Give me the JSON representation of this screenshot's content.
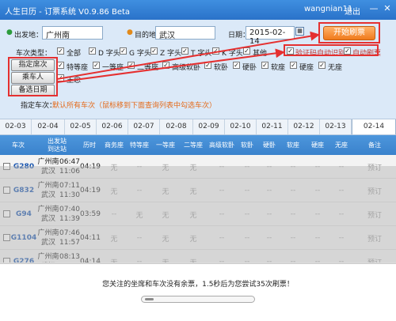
{
  "window": {
    "title": "人生日历 - 订票系统 V0.9.86 Beta",
    "username": "wangnian11",
    "logout": "退出",
    "minimize": "—",
    "close": "✕"
  },
  "form": {
    "from_label": "出发地：",
    "from_value": "广州南",
    "to_label": "目的地：",
    "to_value": "武汉",
    "date_label": "日期：",
    "date_value": "2015-02-14",
    "start_button": "开始刷票",
    "train_type_label": "车次类型：",
    "train_types": [
      {
        "label": "全部",
        "checked": true
      },
      {
        "label": "D 字头",
        "checked": true
      },
      {
        "label": "G 字头",
        "checked": true
      },
      {
        "label": "Z 字头",
        "checked": true
      },
      {
        "label": "T 字头",
        "checked": true
      },
      {
        "label": "K 字头",
        "checked": true
      },
      {
        "label": "其他",
        "checked": true
      }
    ],
    "auto_captcha": "验证码自动识别",
    "auto_refresh": "自动刷票",
    "specify_seat_button": "指定席次",
    "seats": [
      {
        "label": "特等座",
        "checked": true
      },
      {
        "label": "一等座",
        "checked": true
      },
      {
        "label": "二等座",
        "checked": true
      },
      {
        "label": "高级软卧",
        "checked": true
      },
      {
        "label": "软卧",
        "checked": true
      },
      {
        "label": "硬卧",
        "checked": true
      },
      {
        "label": "软座",
        "checked": true
      },
      {
        "label": "硬座",
        "checked": true
      },
      {
        "label": "无座",
        "checked": true
      }
    ],
    "passenger_button": "乘车人",
    "passenger_name": "王念",
    "backup_date_button": "备选日期",
    "specify_train_label": "指定车次：",
    "specify_train_hint": "默认所有车次（鼠标移到下面查询列表中勾选车次）"
  },
  "date_tabs": [
    "02-03",
    "02-04",
    "02-05",
    "02-06",
    "02-07",
    "02-08",
    "02-09",
    "02-10",
    "02-11",
    "02-12",
    "02-13",
    "02-14"
  ],
  "active_tab": "02-14",
  "table": {
    "headers": [
      "车次",
      "出发站\n到达站",
      "历时",
      "商务座",
      "特等座",
      "一等座",
      "二等座",
      "高级软卧",
      "软卧",
      "硬卧",
      "软座",
      "硬座",
      "无座",
      "备注"
    ],
    "rows": [
      {
        "code": "G280",
        "from": "广州南",
        "to": "武汉",
        "dep": "06:47",
        "arr": "11:06",
        "dur": "04:19",
        "seats": [
          "无",
          "--",
          "无",
          "无",
          "--",
          "--",
          "--",
          "--",
          "--",
          "--"
        ],
        "note": "预订"
      },
      {
        "code": "G832",
        "from": "广州南",
        "to": "武汉",
        "dep": "07:11",
        "arr": "11:30",
        "dur": "04:19",
        "seats": [
          "无",
          "--",
          "无",
          "无",
          "--",
          "--",
          "--",
          "--",
          "--",
          "--"
        ],
        "note": "预订"
      },
      {
        "code": "G94",
        "from": "广州南",
        "to": "武汉",
        "dep": "07:40",
        "arr": "11:39",
        "dur": "03:59",
        "seats": [
          "--",
          "无",
          "无",
          "无",
          "--",
          "--",
          "--",
          "--",
          "--",
          "--"
        ],
        "note": "预订"
      },
      {
        "code": "G1104",
        "from": "广州南",
        "to": "武汉",
        "dep": "07:46",
        "arr": "11:57",
        "dur": "04:11",
        "seats": [
          "无",
          "--",
          "无",
          "无",
          "--",
          "--",
          "--",
          "--",
          "--",
          "--"
        ],
        "note": "预订"
      },
      {
        "code": "G276",
        "from": "广州南",
        "to": "武汉",
        "dep": "08:13",
        "arr": "12:27",
        "dur": "04:14",
        "seats": [
          "无",
          "--",
          "无",
          "无",
          "--",
          "--",
          "--",
          "--",
          "--",
          "--"
        ],
        "note": "预订"
      }
    ]
  },
  "dialog": {
    "message": "您关注的坐席和车次没有余票，1.5秒后为您尝试35次刷票！",
    "progress": 0.08
  },
  "colors": {
    "titlebar": "#2a72c9",
    "accent_orange": "#f07a1c",
    "highlight_red": "#e53030"
  }
}
